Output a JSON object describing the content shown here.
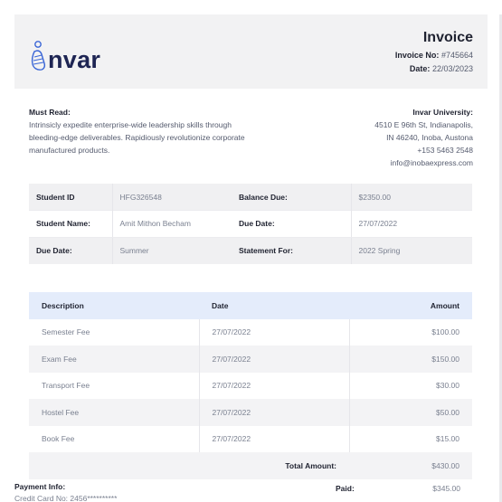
{
  "brand": {
    "name": "nvar",
    "color": "#1e2553",
    "icon": "person-logo-icon"
  },
  "invoice": {
    "title": "Invoice",
    "number_label": "Invoice No:",
    "number": "#745664",
    "date_label": "Date:",
    "date": "22/03/2023"
  },
  "notice": {
    "heading": "Must Read:",
    "body": "Intrinsicly expedite enterprise-wide leadership skills through bleeding-edge deliverables. Rapidiously revolutionize corporate manufactured products."
  },
  "university": {
    "name": "Invar University:",
    "address_1": "4510 E 96th St, Indianapolis,",
    "address_2": "IN 46240, Inoba, Austona",
    "phone": "+153 5463 2548",
    "email": "info@inobaexpress.com"
  },
  "student_info": [
    {
      "l1": "Student ID",
      "v1": "HFG326548",
      "l2": "Balance Due:",
      "v2": "$2350.00"
    },
    {
      "l1": "Student Name:",
      "v1": "Amit Mithon Becham",
      "l2": "Due Date:",
      "v2": "27/07/2022"
    },
    {
      "l1": "Due Date:",
      "v1": "Summer",
      "l2": "Statement For:",
      "v2": "2022 Spring"
    }
  ],
  "items_table": {
    "headers": {
      "description": "Description",
      "date": "Date",
      "amount": "Amount"
    },
    "rows": [
      {
        "description": "Semester Fee",
        "date": "27/07/2022",
        "amount": "$100.00"
      },
      {
        "description": "Exam Fee",
        "date": "27/07/2022",
        "amount": "$150.00"
      },
      {
        "description": "Transport Fee",
        "date": "27/07/2022",
        "amount": "$30.00"
      },
      {
        "description": "Hostel Fee",
        "date": "27/07/2022",
        "amount": "$50.00"
      },
      {
        "description": "Book Fee",
        "date": "27/07/2022",
        "amount": "$15.00"
      }
    ],
    "total_label": "Total Amount:",
    "total_value": "$430.00"
  },
  "payment": {
    "heading": "Payment Info:",
    "card": "Credit Card No: 2456**********",
    "paid_label": "Paid:",
    "paid_value": "$345.00"
  },
  "colors": {
    "header_bg": "#f2f2f3",
    "table_header_bg": "#e4ecfb",
    "accent": "#3a66d6"
  }
}
